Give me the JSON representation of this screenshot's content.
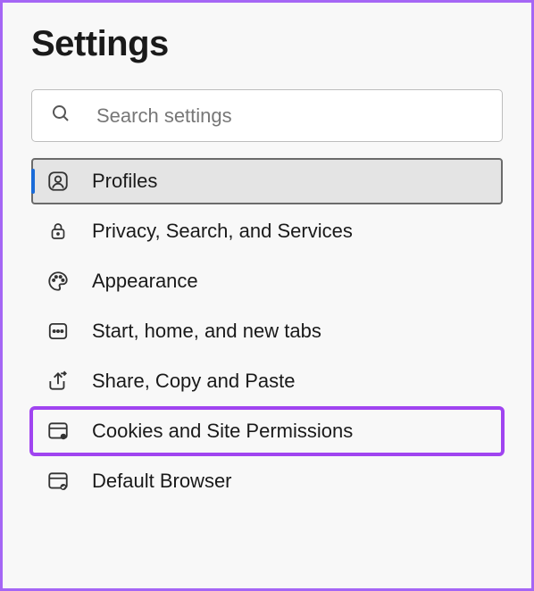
{
  "page_title": "Settings",
  "search": {
    "placeholder": "Search settings"
  },
  "nav": {
    "items": [
      {
        "label": "Profiles"
      },
      {
        "label": "Privacy, Search, and Services"
      },
      {
        "label": "Appearance"
      },
      {
        "label": "Start, home, and new tabs"
      },
      {
        "label": "Share, Copy and Paste"
      },
      {
        "label": "Cookies and Site Permissions"
      },
      {
        "label": "Default Browser"
      }
    ]
  }
}
